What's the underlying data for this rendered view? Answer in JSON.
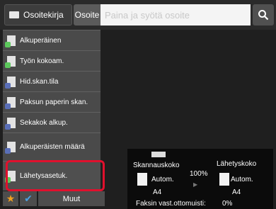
{
  "topbar": {
    "tab_addressbook": "Osoitekirja",
    "tab_address": "Osoite",
    "address_placeholder": "Paina ja syötä osoite",
    "search_icon": "search-icon"
  },
  "sidebar": {
    "items": [
      {
        "label": "Alkuperäinen",
        "icon": "original-icon",
        "accent": "#5cc85c"
      },
      {
        "label": "Työn kokoam.",
        "icon": "job-build-icon",
        "accent": "#5cc85c"
      },
      {
        "label": "Hid.skan.tila",
        "icon": "slow-scan-icon",
        "accent": "#5a6fb8"
      },
      {
        "label": "Paksun paperin skan.",
        "icon": "thick-paper-icon",
        "accent": "#5a6fb8"
      },
      {
        "label": "Sekakok alkup.",
        "icon": "mixed-size-icon",
        "accent": "#5a6fb8"
      },
      {
        "label": "Alkuperäisten määrä",
        "icon": "original-count-icon",
        "accent": "#5a6fb8"
      },
      {
        "label": "Lähetysasetuk.",
        "icon": "send-settings-icon",
        "accent": "#5cc85c"
      }
    ]
  },
  "bottom": {
    "star_icon": "star-icon",
    "check_icon": "check-icon",
    "more_label": "Muut"
  },
  "panel": {
    "scan_size_label": "Skannauskoko",
    "scan_size_value": "Autom.",
    "scan_paper": "A4",
    "ratio": "100%",
    "send_size_label": "Lähetyskoko",
    "send_size_value": "Autom.",
    "send_paper": "A4",
    "fax_label": "Faksin vast.ottomuisti:",
    "fax_value": "0%"
  },
  "colors": {
    "highlight": "#e0102d",
    "star": "#f0a020",
    "check": "#4aa0e0"
  }
}
